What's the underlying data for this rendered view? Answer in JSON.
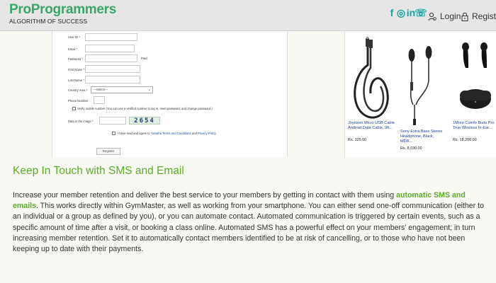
{
  "header": {
    "brand_name": "ProProgrammers",
    "brand_tagline": "ALGORITHM OF SUCCESS",
    "social_icons": [
      "facebook-icon",
      "instagram-icon",
      "linkedin-icon",
      "whatsapp-icon"
    ],
    "social_glyphs": [
      "f",
      "◎",
      "in",
      "☏"
    ],
    "login_label": "Login",
    "register_label": "Register",
    "accent_color": "#3aa66a"
  },
  "form": {
    "user_id_label": "User ID *",
    "email_label": "Email *",
    "password_label": "Password *",
    "password_toggle": "Pwd",
    "first_name_label": "First Name *",
    "last_name_label": "Last Name *",
    "country_area_label": "Country Area *",
    "country_select_value": "---Select---",
    "phone_label": "Phone Number",
    "verify_text": "Verify mobile number (You can use a verified number to log in, reset password, and change password.)",
    "captcha_label": "Data in the image *",
    "captcha_value": "2654",
    "terms_prefix": "I have read and agree to",
    "terms_link": "Yamaha Terms and Conditions",
    "terms_mid": "and",
    "privacy_link": "Privacy Policy",
    "register_button": "Register"
  },
  "products": [
    {
      "title": "Joyroom Micro USB Cable Android Data Cable, 9ft...",
      "price": "Rs. 325.00"
    },
    {
      "title": "Sony Extra Bass Stereo Headphone, Black, MDR...",
      "price": "Rs. 8,030.00"
    },
    {
      "title": "1More Comfo Buds Pro True Wireless In-Ear...",
      "price": "Rs. 18,200.00"
    }
  ],
  "article": {
    "heading": "Keep In Touch with SMS and Email",
    "text_before": "Increase your member retention and deliver the best service to your members by getting in contact with them using ",
    "highlight": "automatic SMS and emails",
    "text_after": ". This works directly within GymMaster, as well as working from your smartphone. You can either send one-off communication (either to an individual or a group as defined by you), or you can automate contact. Automated communication is triggered by certain events, such as a specific amount of time after a visit, or booking a class online. Automated SMS has a powerful effect on your members' engagement; in turn increasing member retention. Set it to automatically contact members identified to be at risk of cancelling, or to those who have not been keeping up to date with their payments.",
    "heading_color": "#5cae2a"
  }
}
